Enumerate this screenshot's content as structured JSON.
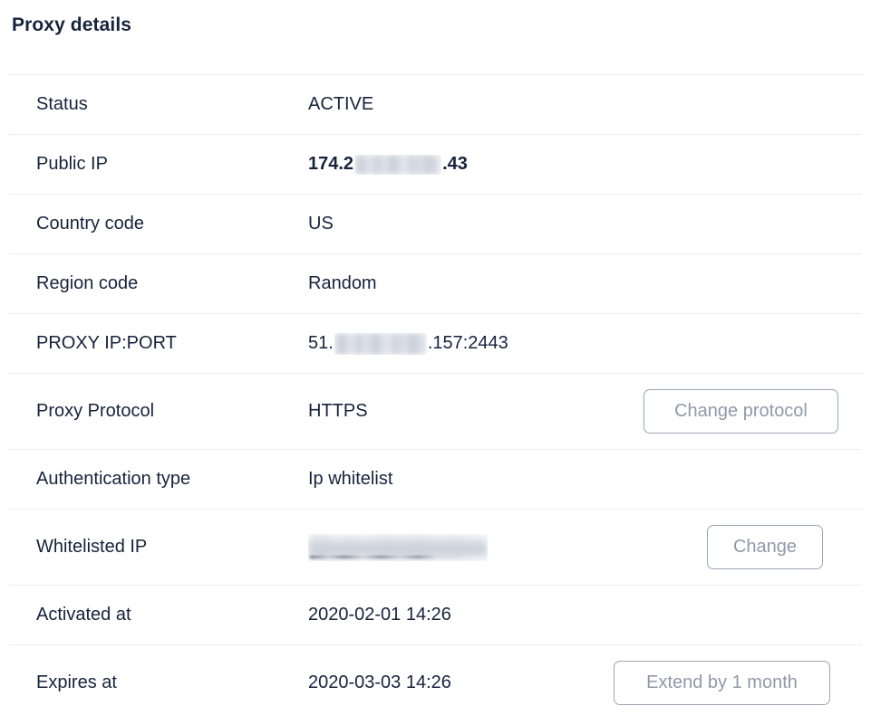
{
  "header": {
    "title": "Proxy details"
  },
  "colors": {
    "text": "#16233c",
    "divider": "#e9ecef",
    "button_border": "#9aa5b5",
    "button_text": "#9099a8",
    "background": "#ffffff"
  },
  "details": {
    "rows": [
      {
        "label": "Status",
        "value": "ACTIVE",
        "bold": false,
        "redacted": false,
        "action": null
      },
      {
        "label": "Public IP",
        "value_prefix": "174.2",
        "value_suffix": ".43",
        "bold": true,
        "redacted": true,
        "action": null
      },
      {
        "label": "Country code",
        "value": "US",
        "bold": false,
        "redacted": false,
        "action": null
      },
      {
        "label": "Region code",
        "value": "Random",
        "bold": false,
        "redacted": false,
        "action": null
      },
      {
        "label": "PROXY IP:PORT",
        "value_prefix": "51.",
        "value_suffix": ".157:2443",
        "bold": false,
        "redacted": true,
        "action": null
      },
      {
        "label": "Proxy Protocol",
        "value": "HTTPS",
        "bold": false,
        "redacted": false,
        "action": "Change protocol"
      },
      {
        "label": "Authentication type",
        "value": "Ip whitelist",
        "bold": false,
        "redacted": false,
        "action": null
      },
      {
        "label": "Whitelisted IP",
        "value": "",
        "bold": false,
        "redacted": true,
        "action": "Change"
      },
      {
        "label": "Activated at",
        "value": "2020-02-01 14:26",
        "bold": false,
        "redacted": false,
        "action": null
      },
      {
        "label": "Expires at",
        "value": "2020-03-03 14:26",
        "bold": false,
        "redacted": false,
        "action": "Extend by 1 month"
      }
    ]
  }
}
